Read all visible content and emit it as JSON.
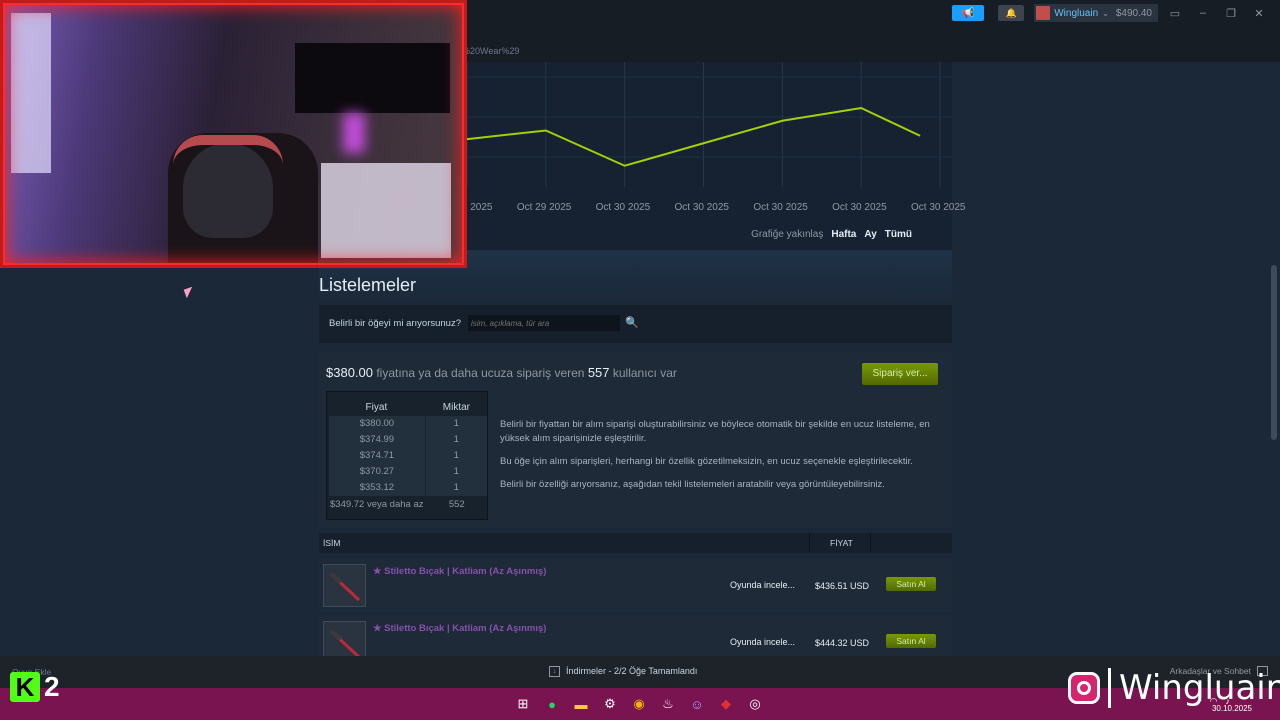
{
  "topbar": {
    "url_fragment": "al%20Wear%29",
    "account_name": "Wingluain",
    "balance": "$490.40"
  },
  "chart_data": {
    "type": "line",
    "x": [
      "Oct 29 2025",
      "Oct 29 2025",
      "Oct 30 2025",
      "Oct 30 2025",
      "Oct 30 2025",
      "Oct 30 2025",
      "Oct 30 2025"
    ],
    "series": [
      {
        "values": [
          null,
          0.62,
          0.15,
          0.45,
          0.75,
          0.92,
          0.55
        ]
      }
    ],
    "line_color": "#a4d007",
    "grid": true
  },
  "chart": {
    "zoom_label": "Grafiğe yakınlaş",
    "zoom_options": [
      "Hafta",
      "Ay",
      "Tümü"
    ]
  },
  "listings": {
    "title": "Listelemeler",
    "search_question": "Belirli bir öğeyi mi arıyorsunuz?",
    "search_placeholder": "isim, açıklama, tür ara"
  },
  "order": {
    "price": "$380.00",
    "text_mid": "fiyatına ya da daha ucuza sipariş veren",
    "count": "557",
    "text_end": "kullanıcı var",
    "button": "Sipariş ver...",
    "col_price": "Fiyat",
    "col_qty": "Miktar",
    "rows": [
      {
        "price": "$380.00",
        "qty": "1"
      },
      {
        "price": "$374.99",
        "qty": "1"
      },
      {
        "price": "$374.71",
        "qty": "1"
      },
      {
        "price": "$370.27",
        "qty": "1"
      },
      {
        "price": "$353.12",
        "qty": "1"
      }
    ],
    "last_row": {
      "price": "$349.72 veya daha az",
      "qty": "552"
    },
    "info": [
      "Belirli bir fiyattan bir alım siparişi oluşturabilirsiniz ve böylece otomatik bir şekilde en ucuz listeleme, en yüksek alım siparişinizle eşleştirilir.",
      "Bu öğe için alım siparişleri, herhangi bir özellik gözetilmeksizin, en ucuz seçenekle eşleştirilecektir.",
      "Belirli bir özelliği arıyorsanız, aşağıdan tekil listelemeleri aratabilir veya görüntüleyebilirsiniz."
    ]
  },
  "list_header": {
    "name": "İSİM",
    "price": "FİYAT"
  },
  "list_rows": [
    {
      "name": "★ Stiletto Bıçak | Katliam (Az Aşınmış)",
      "inspect": "Oyunda incele...",
      "price": "$436.51 USD",
      "buy": "Satın Al"
    },
    {
      "name": "★ Stiletto Bıçak | Katliam (Az Aşınmış)",
      "inspect": "Oyunda incele...",
      "price": "$444.32 USD",
      "buy": "Satın Al"
    }
  ],
  "statusbar": {
    "add_game": "Oyun Ekle",
    "downloads": "İndirmeler - 2/2 Öğe Tamamlandı",
    "friends": "Arkadaşlar ve Sohbet"
  },
  "taskbar": {
    "date": "30.10.2025"
  },
  "overlay": {
    "kick_number": "2",
    "instagram_user": "Wingluain"
  },
  "colors": {
    "accent": "#1a9fff",
    "green_button": "#799905",
    "item_name": "#8650ac",
    "webcam_frame": "#c21b1b",
    "taskbar": "#7a1450"
  }
}
